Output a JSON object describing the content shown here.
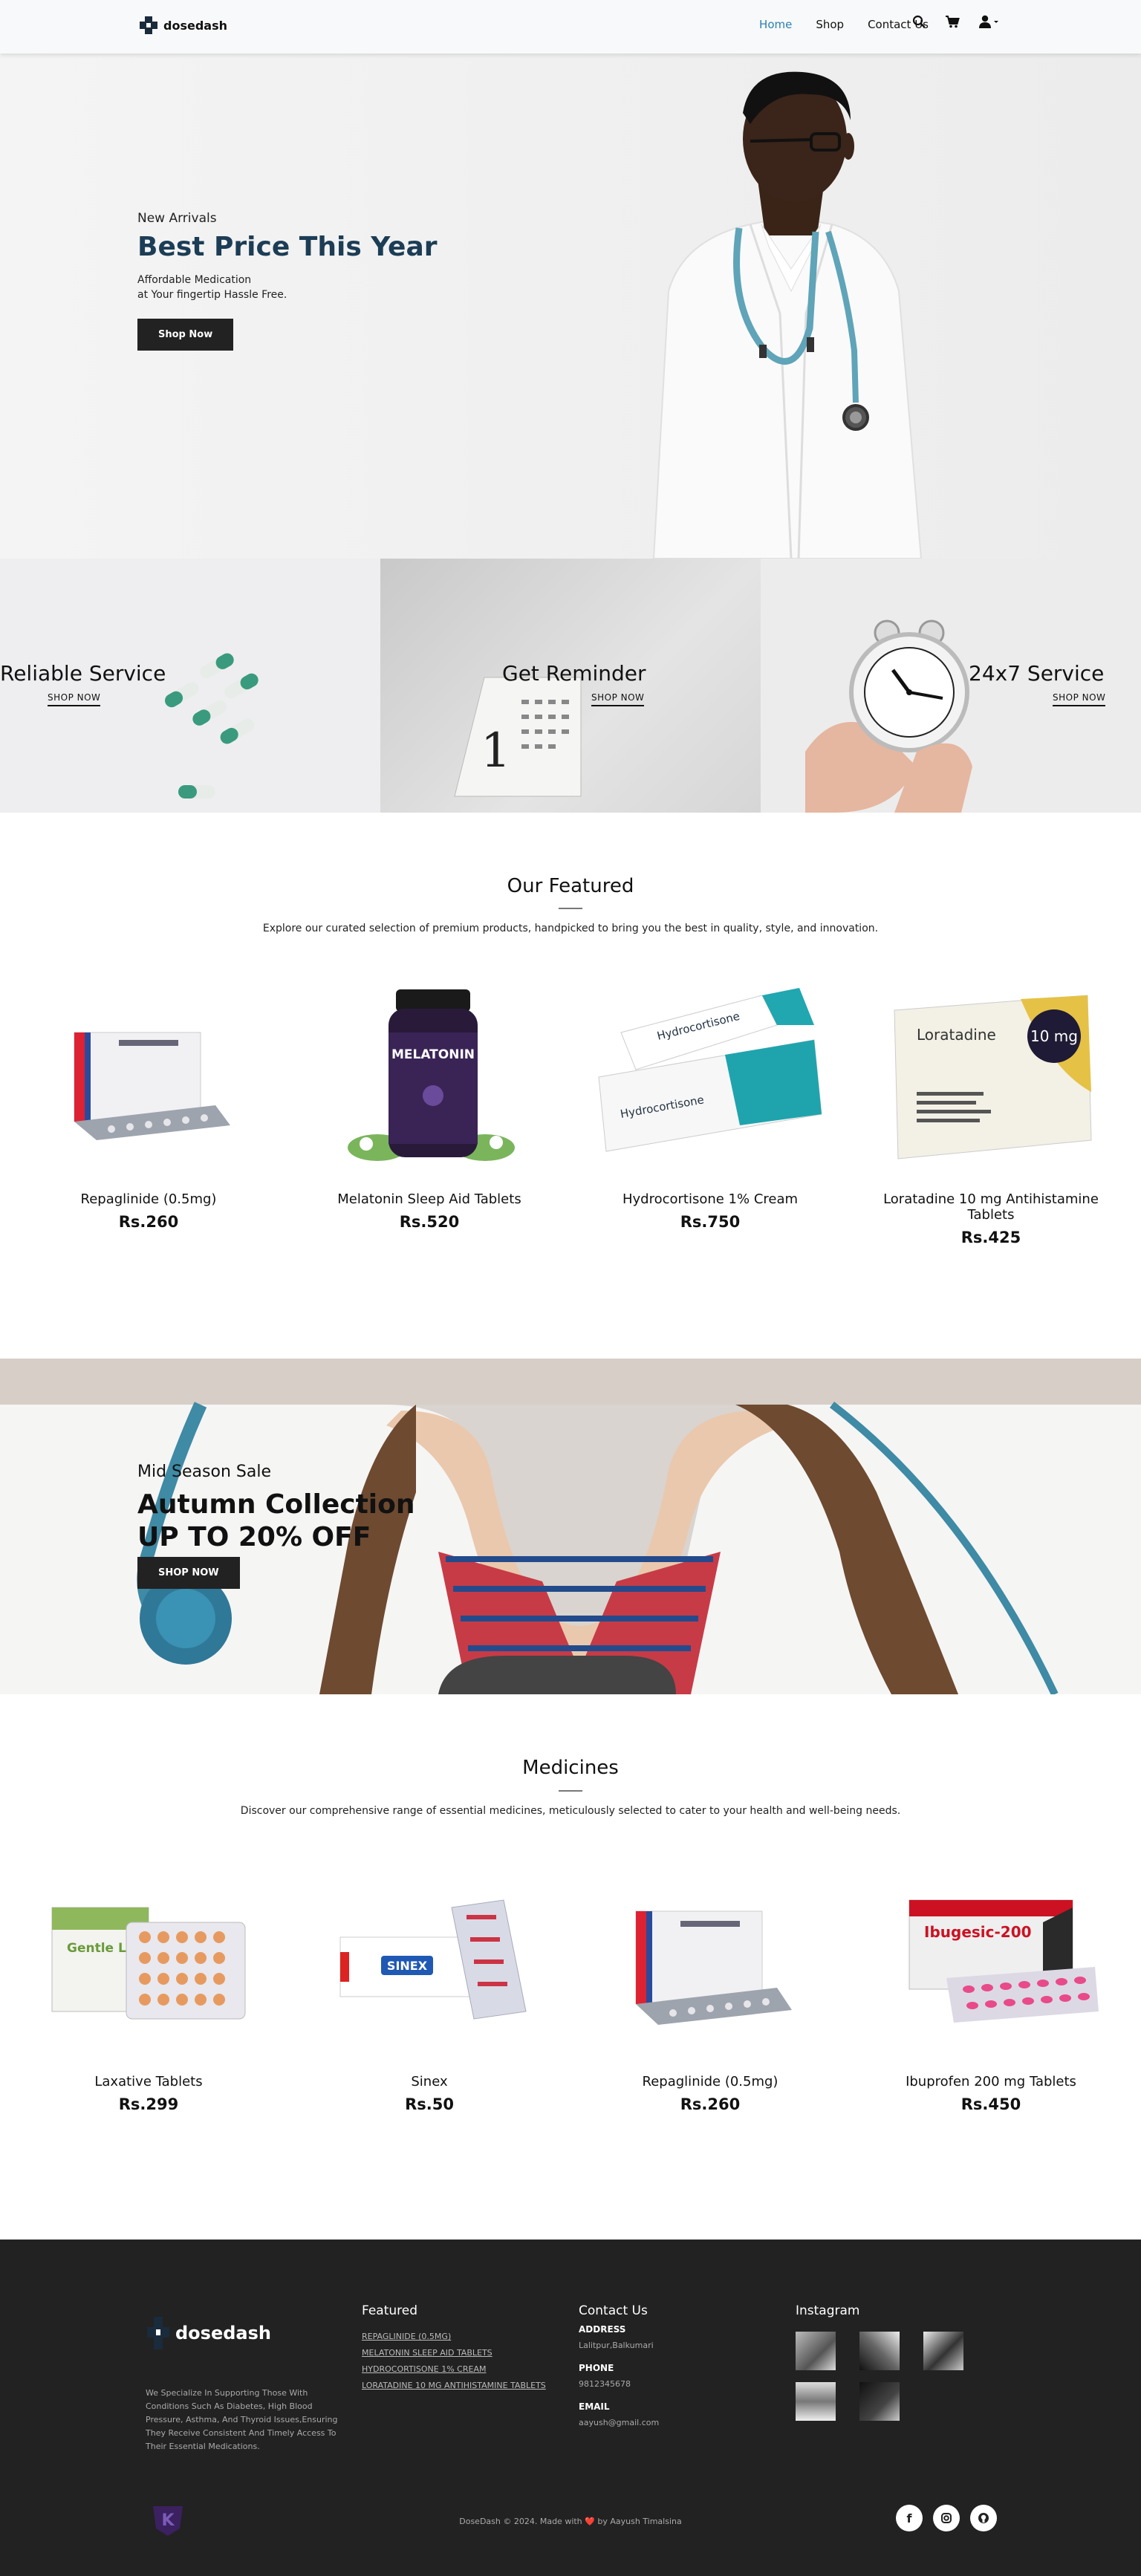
{
  "nav": {
    "brand": "dosedash",
    "links": [
      "Home",
      "Shop",
      "Contact Us"
    ],
    "active": "Home"
  },
  "hero": {
    "subtitle": "New Arrivals",
    "title": "Best Price This Year",
    "desc_line1": "Affordable Medication",
    "desc_line2": "at Your fingertip Hassle Free.",
    "button": "Shop Now"
  },
  "services": [
    {
      "title": "Reliable Service",
      "link": "SHOP NOW"
    },
    {
      "title": "Get Reminder",
      "link": "SHOP NOW"
    },
    {
      "title": "24x7 Service",
      "link": "SHOP NOW"
    }
  ],
  "featured": {
    "title": "Our Featured",
    "desc": "Explore our curated selection of premium products, handpicked to bring you the best in quality, style, and innovation.",
    "products": [
      {
        "name": "Repaglinide (0.5mg)",
        "price": "Rs.260"
      },
      {
        "name": "Melatonin Sleep Aid Tablets",
        "price": "Rs.520"
      },
      {
        "name": "Hydrocortisone 1% Cream",
        "price": "Rs.750"
      },
      {
        "name": "Loratadine 10 mg Antihistamine Tablets",
        "price": "Rs.425"
      }
    ]
  },
  "sale": {
    "subtitle": "Mid Season Sale",
    "title_line1": "Autumn Collection",
    "title_line2": "UP TO 20% OFF",
    "button": "SHOP NOW"
  },
  "medicines": {
    "title": "Medicines",
    "desc": "Discover our comprehensive range of essential medicines, meticulously selected to cater to your health and well-being needs.",
    "products": [
      {
        "name": "Laxative Tablets",
        "price": "Rs.299"
      },
      {
        "name": "Sinex",
        "price": "Rs.50"
      },
      {
        "name": "Repaglinide (0.5mg)",
        "price": "Rs.260"
      },
      {
        "name": "Ibuprofen 200 mg Tablets",
        "price": "Rs.450"
      }
    ]
  },
  "product_art": {
    "melatonin": "MELATONIN",
    "hydrocortisone": "Hydrocortisone",
    "loratadine": "Loratadine",
    "loratadine_dose": "10 mg",
    "gentle": "Gentle Laxative",
    "sinex": "SINEX",
    "ibugesic": "Ibugesic-200"
  },
  "footer": {
    "brand": "dosedash",
    "about": "We Specialize In Supporting Those With Conditions Such As Diabetes, High Blood Pressure, Asthma, And Thyroid Issues,Ensuring They Receive Consistent And Timely Access To Their Essential Medications.",
    "featured_title": "Featured",
    "featured_links": [
      "REPAGLINIDE (0.5MG)",
      "MELATONIN SLEEP AID TABLETS",
      "HYDROCORTISONE 1% CREAM",
      "LORATADINE 10 MG ANTIHISTAMINE TABLETS"
    ],
    "contact_title": "Contact Us",
    "address_label": "ADDRESS",
    "address": "Lalitpur,Balkumari",
    "phone_label": "PHONE",
    "phone": "9812345678",
    "email_label": "EMAIL",
    "email": "aayush@gmail.com",
    "instagram_title": "Instagram",
    "copyright": "DoseDash © 2024. Made with ❤️ by Aayush Timalsina"
  },
  "colors": {
    "accent": "#2a7fb8",
    "title": "#1c3d55",
    "footer_bg": "#222222"
  }
}
